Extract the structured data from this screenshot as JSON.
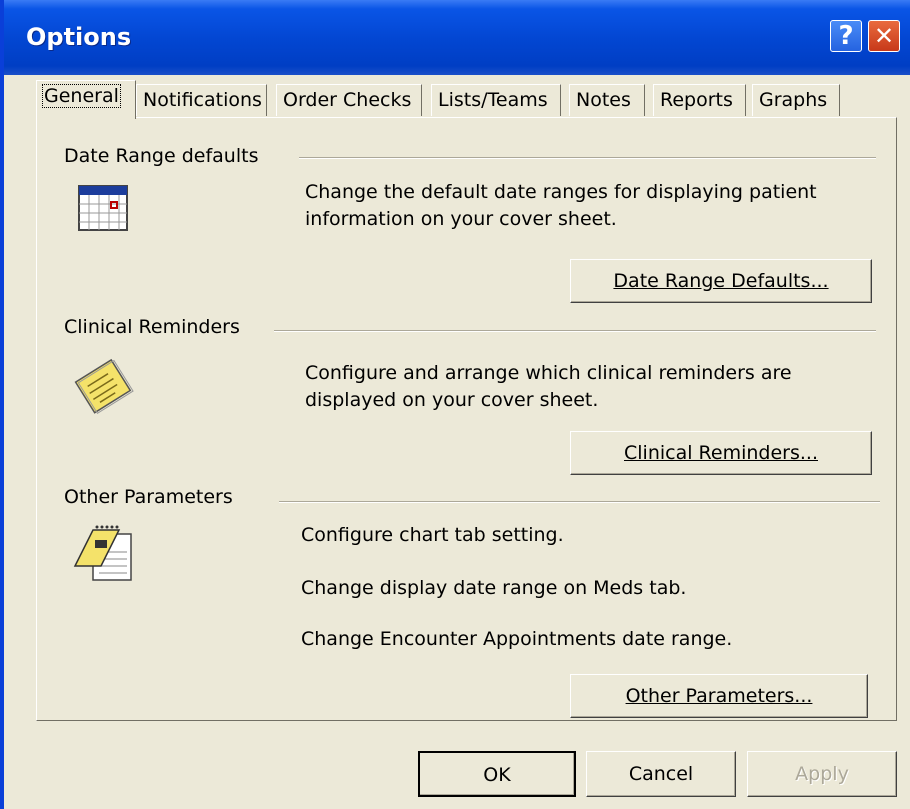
{
  "window": {
    "title": "Options"
  },
  "titlebar_buttons": {
    "help": "?",
    "close": "✕"
  },
  "tabs": [
    {
      "label": "General",
      "active": true
    },
    {
      "label": "Notifications"
    },
    {
      "label": "Order Checks"
    },
    {
      "label": "Lists/Teams"
    },
    {
      "label": "Notes"
    },
    {
      "label": "Reports"
    },
    {
      "label": "Graphs"
    }
  ],
  "groups": {
    "date_range": {
      "heading": "Date Range defaults",
      "description": "Change the default date ranges for displaying patient information on your cover sheet.",
      "button": "Date Range Defaults...",
      "icon": "calendar-icon"
    },
    "clinical_reminders": {
      "heading": "Clinical Reminders",
      "description": "Configure and arrange which clinical reminders are displayed on your cover sheet.",
      "button": "Clinical Reminders...",
      "icon": "sticky-note-icon"
    },
    "other_parameters": {
      "heading": "Other Parameters",
      "lines": [
        "Configure chart tab setting.",
        "Change display date range on Meds tab.",
        "Change Encounter Appointments date range."
      ],
      "button": "Other Parameters...",
      "icon": "notepad-icon"
    }
  },
  "footer": {
    "ok": "OK",
    "cancel": "Cancel",
    "apply": "Apply"
  },
  "colors": {
    "titlebar": "#0347d3",
    "face": "#ece9d8",
    "close": "#c7391a"
  }
}
